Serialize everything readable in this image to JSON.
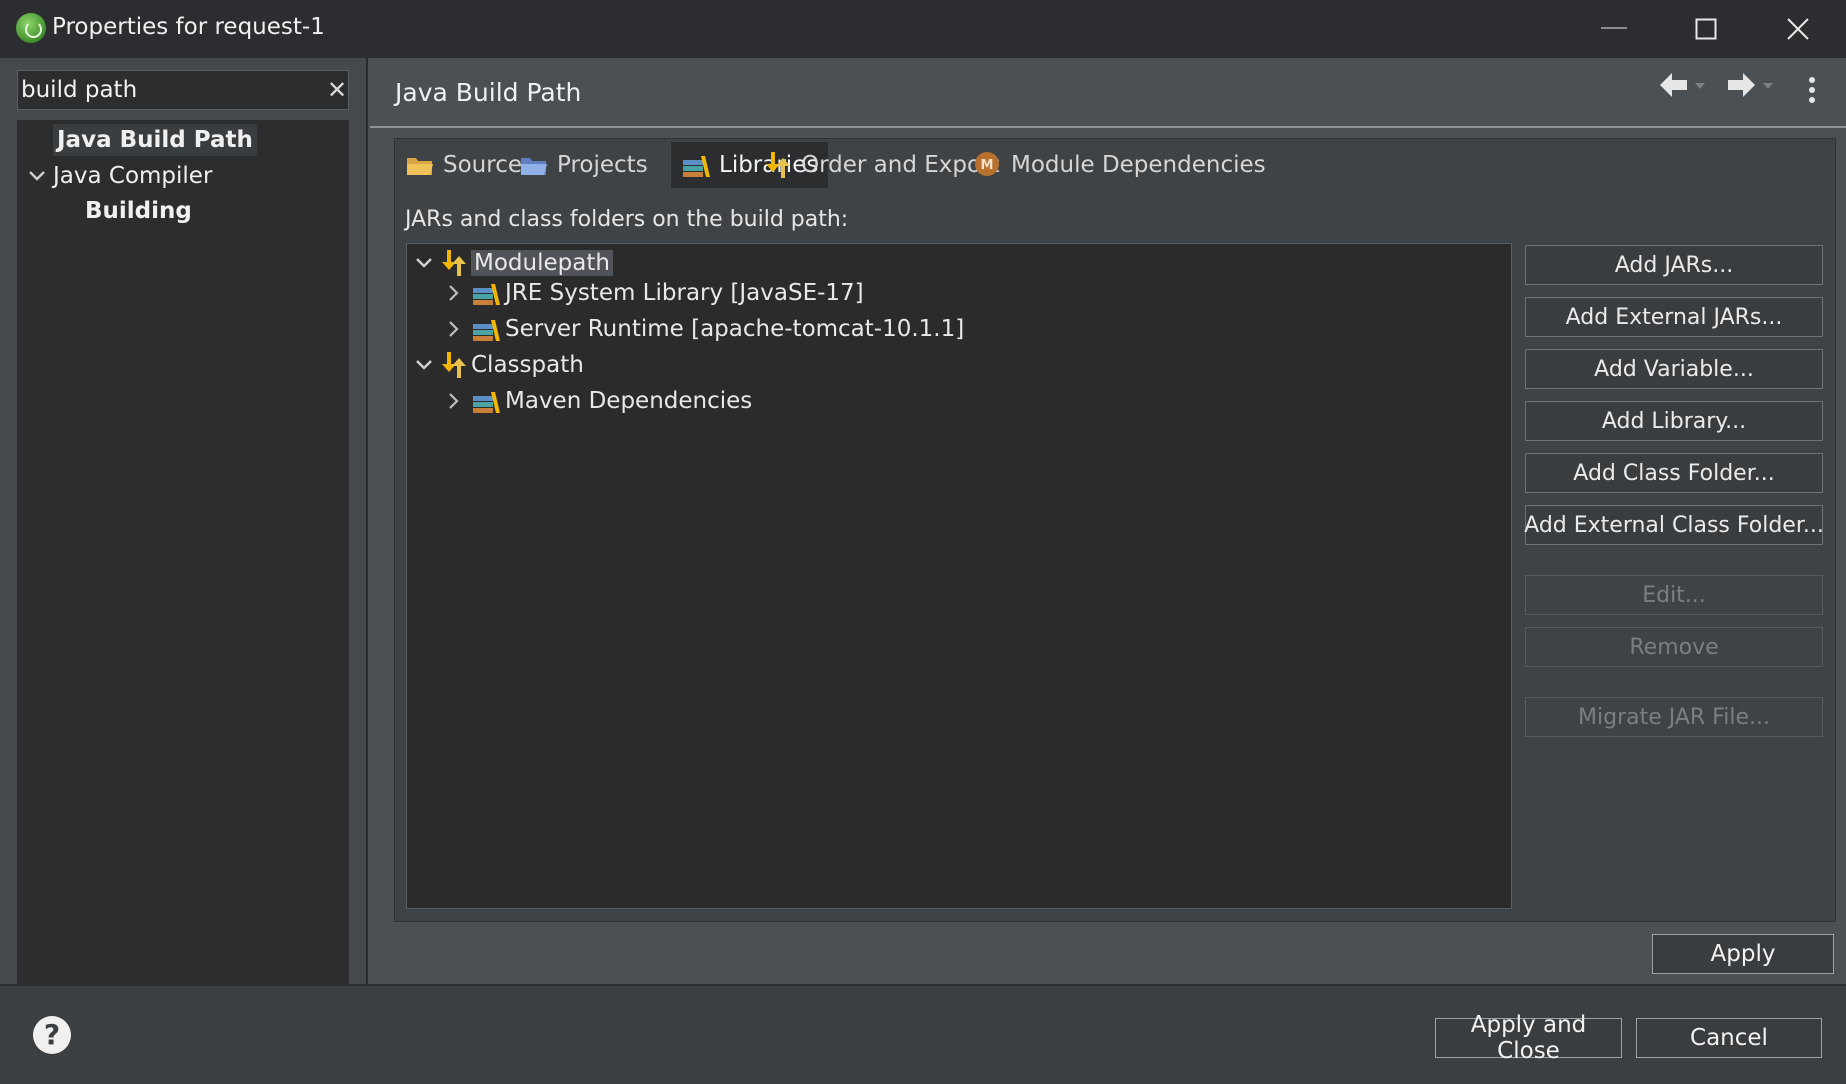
{
  "window": {
    "title": "Properties for request-1",
    "minimize_icon": "minimize-icon",
    "maximize_icon": "maximize-icon",
    "close_icon": "close-icon"
  },
  "sidebar": {
    "filter_value": "build path",
    "items": [
      {
        "label": "Java Build Path"
      },
      {
        "label": "Java Compiler"
      },
      {
        "label": "Building"
      }
    ]
  },
  "page": {
    "title": "Java Build Path",
    "tabs": [
      {
        "label": "Source"
      },
      {
        "label": "Projects"
      },
      {
        "label": "Libraries"
      },
      {
        "label": "Order and Export"
      },
      {
        "label": "Module Dependencies"
      }
    ],
    "active_tab": "Libraries",
    "libraries_label": "JARs and class folders on the build path:",
    "tree": [
      {
        "label": "Modulepath"
      },
      {
        "label": "JRE System Library [JavaSE-17]"
      },
      {
        "label": "Server Runtime [apache-tomcat-10.1.1]"
      },
      {
        "label": "Classpath"
      },
      {
        "label": "Maven Dependencies"
      }
    ],
    "buttons": [
      {
        "label": "Add JARs..."
      },
      {
        "label": "Add External JARs..."
      },
      {
        "label": "Add Variable..."
      },
      {
        "label": "Add Library..."
      },
      {
        "label": "Add Class Folder..."
      },
      {
        "label": "Add External Class Folder..."
      },
      {
        "label": "Edit..."
      },
      {
        "label": "Remove"
      },
      {
        "label": "Migrate JAR File..."
      }
    ],
    "apply_label": "Apply"
  },
  "footer": {
    "apply_close_label": "Apply and Close",
    "cancel_label": "Cancel"
  },
  "colors": {
    "background": "#4b5054",
    "panel": "#2b2d2f",
    "accent_library": "#f2b705"
  }
}
